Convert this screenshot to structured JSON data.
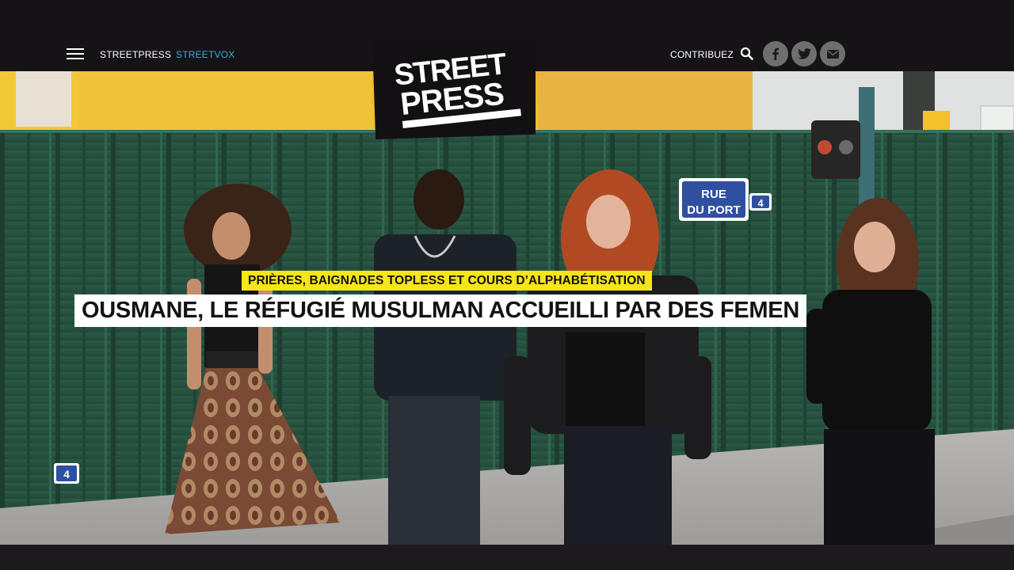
{
  "nav": {
    "streetpress": "STREETPRESS",
    "streetvox": "STREETVOX",
    "contribuez": "CONTRIBUEZ",
    "menu_icon": "hamburger-menu-icon",
    "search_icon": "search-icon",
    "social_icons": [
      "facebook-icon",
      "twitter-icon",
      "mail-icon"
    ]
  },
  "logo": {
    "line1": "STREET",
    "line2": "PRESS"
  },
  "article": {
    "kicker": "PRIÈRES, BAIGNADES TOPLESS ET COURS D’ALPHABÉTISATION",
    "headline": "OUSMANE, LE RÉFUGIÉ MUSULMAN ACCUEILLI PAR DES FEMEN"
  },
  "photo": {
    "street_sign_line1": "RUE",
    "street_sign_line2": "DU PORT",
    "house_number": "4",
    "house_number_small": "4"
  },
  "colors": {
    "topbar": "#151315",
    "accent_link": "#3fa8d8",
    "kicker_bg": "#f5e51b",
    "headline_bg": "#ffffff",
    "social_bg": "#6f6f6f",
    "fence_green": "#2f5a44"
  }
}
